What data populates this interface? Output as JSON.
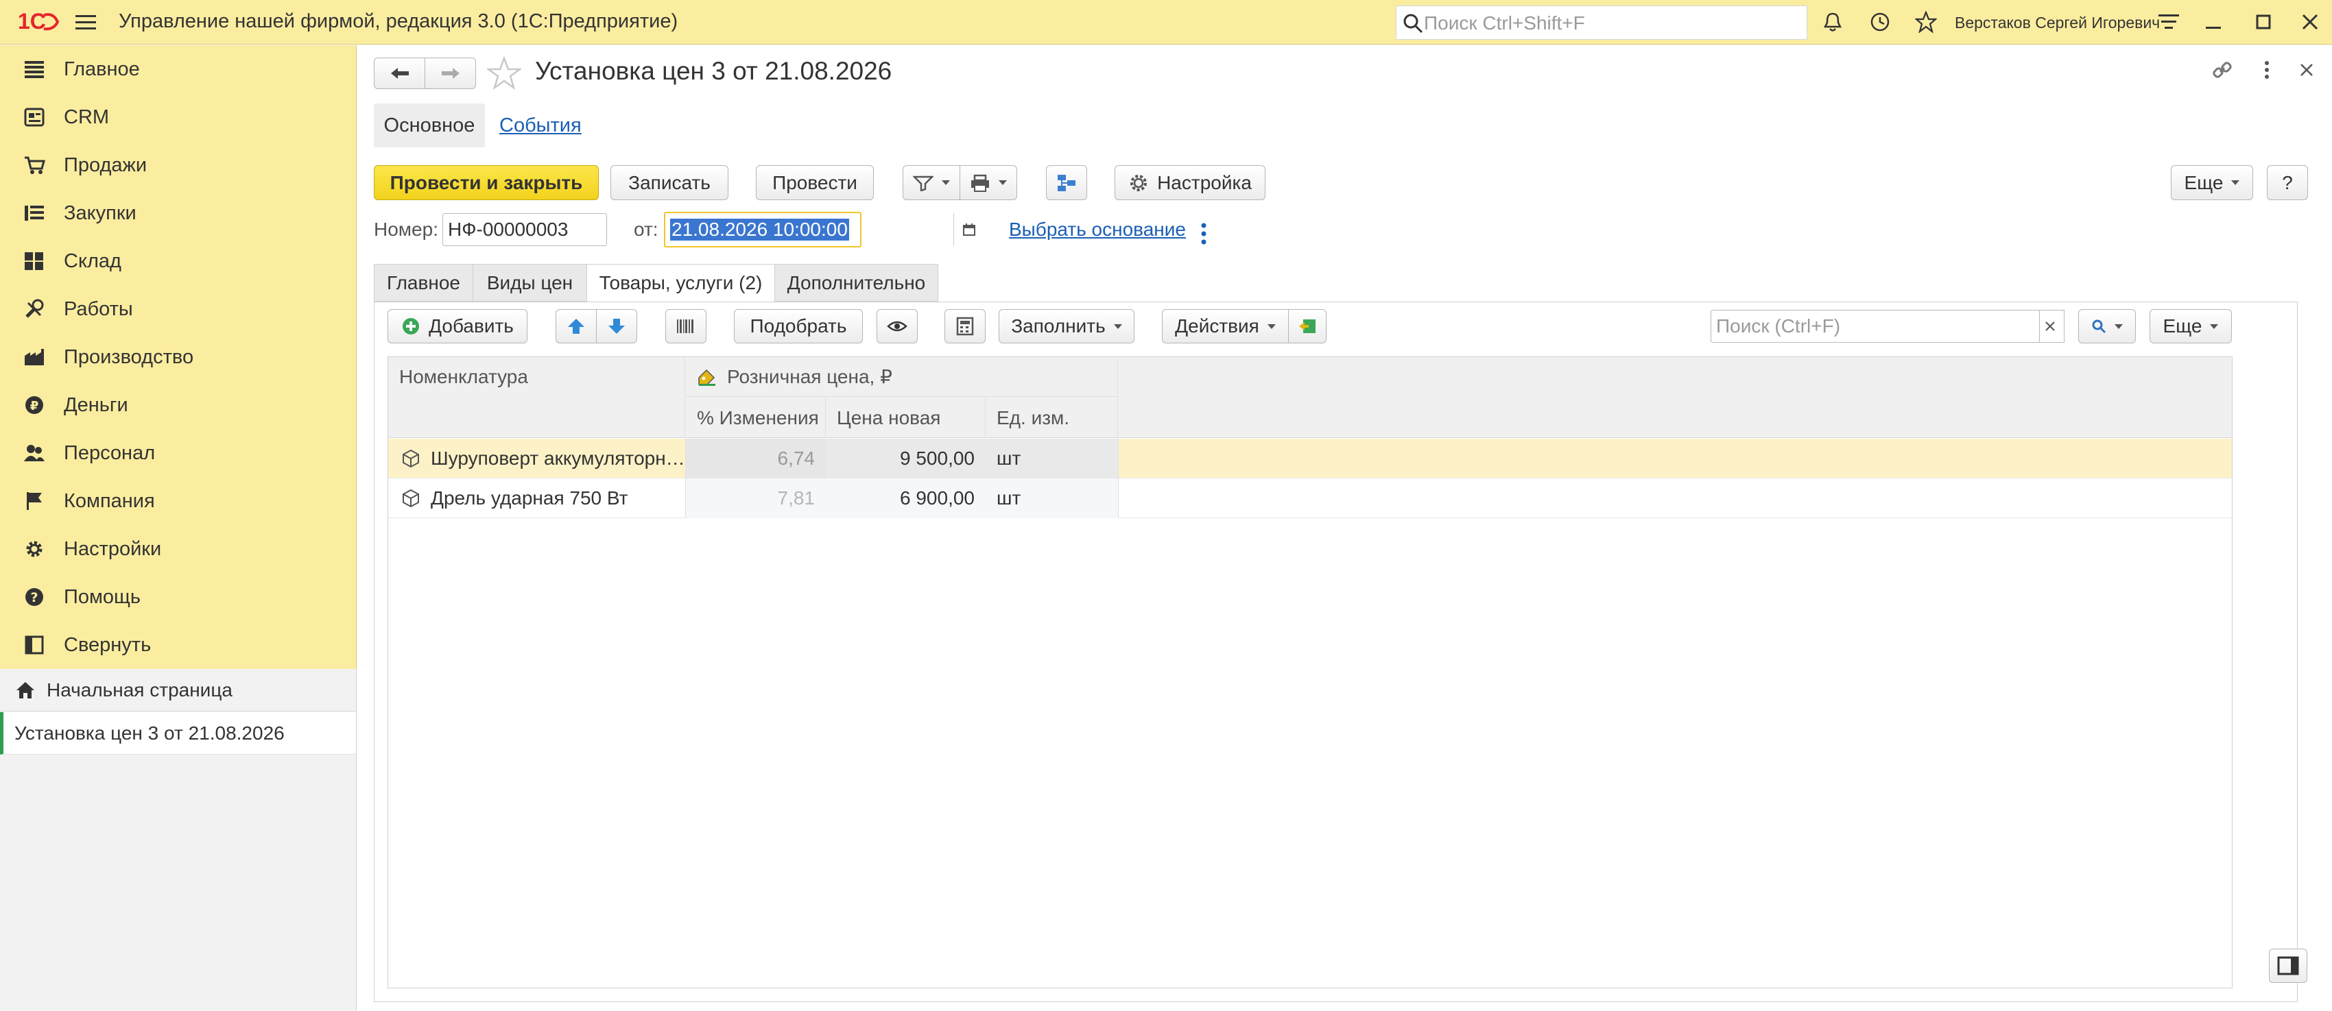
{
  "app": {
    "title": "Управление нашей фирмой, редакция 3.0  (1С:Предприятие)",
    "search_placeholder": "Поиск Ctrl+Shift+F",
    "user": "Верстаков Сергей Игоревич"
  },
  "sidebar": {
    "items": [
      {
        "label": "Главное",
        "icon": "menu-icon"
      },
      {
        "label": "CRM",
        "icon": "crm-icon"
      },
      {
        "label": "Продажи",
        "icon": "cart-icon"
      },
      {
        "label": "Закупки",
        "icon": "purchase-icon"
      },
      {
        "label": "Склад",
        "icon": "warehouse-icon"
      },
      {
        "label": "Работы",
        "icon": "tools-icon"
      },
      {
        "label": "Производство",
        "icon": "factory-icon"
      },
      {
        "label": "Деньги",
        "icon": "money-icon"
      },
      {
        "label": "Персонал",
        "icon": "people-icon"
      },
      {
        "label": "Компания",
        "icon": "flag-icon"
      },
      {
        "label": "Настройки",
        "icon": "gear-icon"
      },
      {
        "label": "Помощь",
        "icon": "help-icon"
      },
      {
        "label": "Свернуть",
        "icon": "collapse-icon"
      }
    ],
    "home": "Начальная страница",
    "open_doc": "Установка цен 3 от 21.08.2026"
  },
  "form": {
    "title": "Установка цен 3 от 21.08.2026",
    "nav_tabs": {
      "main": "Основное",
      "events": "События"
    },
    "toolbar": {
      "post_close": "Провести и закрыть",
      "save": "Записать",
      "post": "Провести",
      "settings": "Настройка",
      "more": "Еще",
      "help": "?"
    },
    "number_label": "Номер:",
    "number_value": "НФ-00000003",
    "date_label": "от:",
    "date_value": "21.08.2026 10:00:00",
    "basis_link": "Выбрать основание",
    "tabs": [
      "Главное",
      "Виды цен",
      "Товары, услуги (2)",
      "Дополнительно"
    ],
    "table_toolbar": {
      "add": "Добавить",
      "pick": "Подобрать",
      "fill": "Заполнить",
      "actions": "Действия",
      "search_placeholder": "Поиск (Ctrl+F)",
      "more": "Еще"
    }
  },
  "table": {
    "col_nomenclature": "Номенклатура",
    "group_header": "Розничная цена, ₽",
    "col_change": "% Изменения",
    "col_price": "Цена новая",
    "col_unit": "Ед. изм.",
    "rows": [
      {
        "name": "Шуруповерт аккумуляторный",
        "change": "6,74",
        "price": "9 500,00",
        "unit": "шт"
      },
      {
        "name": "Дрель ударная 750 Вт",
        "change": "7,81",
        "price": "6 900,00",
        "unit": "шт"
      }
    ]
  },
  "colors": {
    "accent_yellow": "#fbeda0",
    "button_yellow": "#f5d824",
    "selected_row": "#fdf2c7",
    "link_blue": "#1a5fb4",
    "brand_red": "#e5242b"
  }
}
